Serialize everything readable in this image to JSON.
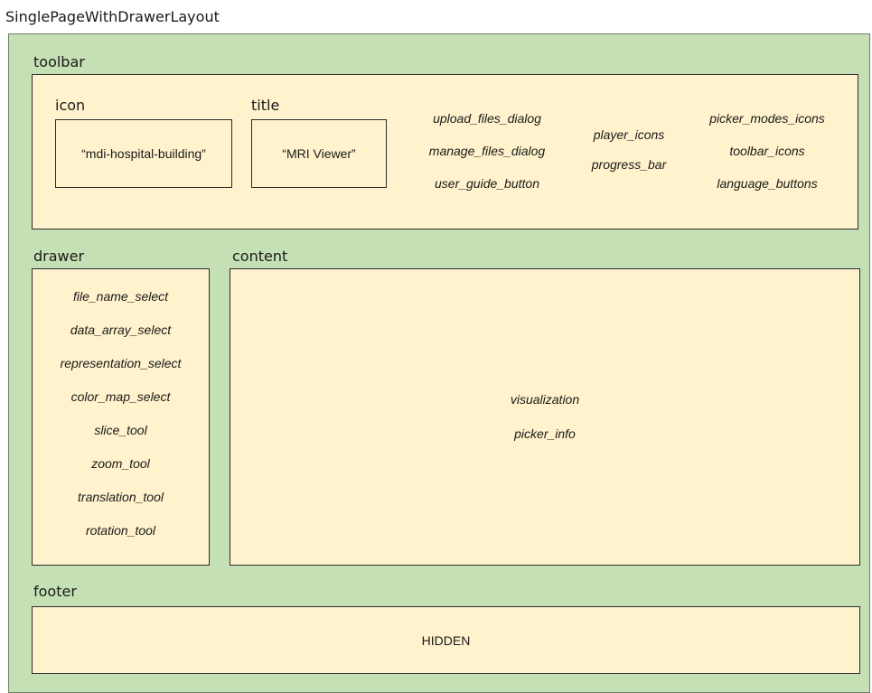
{
  "layout_name": "SinglePageWithDrawerLayout",
  "toolbar": {
    "label": "toolbar",
    "icon": {
      "label": "icon",
      "value": "“mdi-hospital-building”"
    },
    "title": {
      "label": "title",
      "value": "“MRI Viewer”"
    },
    "col1": [
      "upload_files_dialog",
      "manage_files_dialog",
      "user_guide_button"
    ],
    "col2": [
      "player_icons",
      "progress_bar"
    ],
    "col3": [
      "picker_modes_icons",
      "toolbar_icons",
      "language_buttons"
    ]
  },
  "drawer": {
    "label": "drawer",
    "items": [
      "file_name_select",
      "data_array_select",
      "representation_select",
      "color_map_select",
      "slice_tool",
      "zoom_tool",
      "translation_tool",
      "rotation_tool"
    ]
  },
  "content": {
    "label": "content",
    "items": [
      "visualization",
      "picker_info"
    ]
  },
  "footer": {
    "label": "footer",
    "value": "HIDDEN"
  },
  "colors": {
    "outer_background": "#c5e0b4",
    "panel_background": "#fff2cc",
    "border": "#2b2b2b"
  }
}
